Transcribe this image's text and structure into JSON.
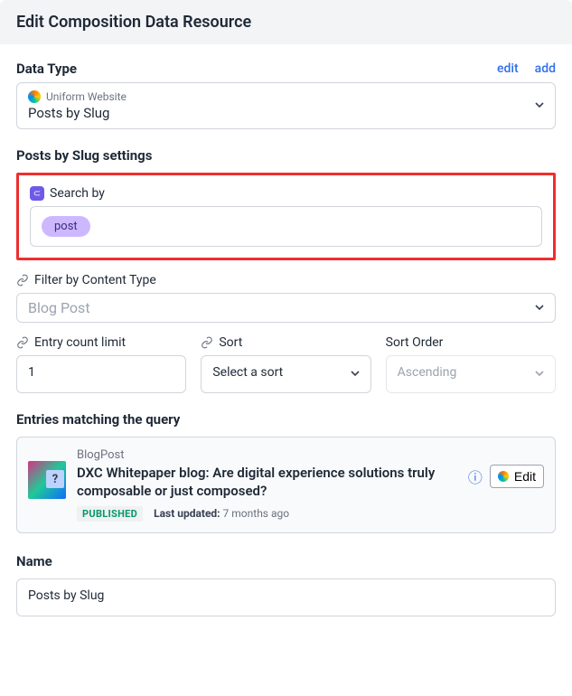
{
  "header": {
    "title": "Edit Composition Data Resource"
  },
  "dataType": {
    "label": "Data Type",
    "editLink": "edit",
    "addLink": "add",
    "resourceName": "Uniform Website",
    "value": "Posts by Slug"
  },
  "settings": {
    "title": "Posts by Slug settings",
    "searchBy": {
      "label": "Search by",
      "chip": "post"
    },
    "filter": {
      "label": "Filter by Content Type",
      "value": "Blog Post"
    },
    "entryCount": {
      "label": "Entry count limit",
      "value": "1"
    },
    "sort": {
      "label": "Sort",
      "placeholder": "Select a sort"
    },
    "sortOrder": {
      "label": "Sort Order",
      "placeholder": "Ascending"
    }
  },
  "entries": {
    "title": "Entries matching the query",
    "item": {
      "type": "BlogPost",
      "title": "DXC Whitepaper blog: Are digital experience solutions truly composable or just composed?",
      "status": "PUBLISHED",
      "updatedLabel": "Last updated:",
      "updatedValue": "7 months ago",
      "editLabel": "Edit"
    }
  },
  "name": {
    "label": "Name",
    "value": "Posts by Slug"
  }
}
